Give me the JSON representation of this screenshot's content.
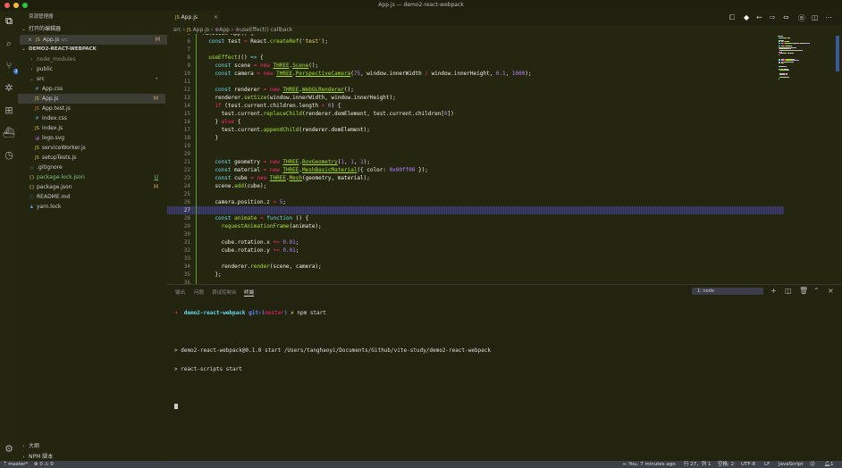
{
  "window": {
    "title": "App.js — demo2-react-webpack"
  },
  "activity_bar": [
    {
      "name": "explorer-icon",
      "glyph": "⧉"
    },
    {
      "name": "search-icon",
      "glyph": "⌕"
    },
    {
      "name": "source-control-icon",
      "glyph": "⑂",
      "badge": "3"
    },
    {
      "name": "debug-icon",
      "glyph": "✲"
    },
    {
      "name": "extensions-icon",
      "glyph": "⊞"
    },
    {
      "name": "docker-icon",
      "glyph": "⛴"
    },
    {
      "name": "timeline-icon",
      "glyph": "◷"
    }
  ],
  "sidebar": {
    "title": "资源管理器",
    "open_editors": {
      "label": "打开的编辑器",
      "items": [
        {
          "name": "App.js",
          "dir": "src",
          "status": "M"
        }
      ]
    },
    "project": {
      "label": "DEMO2-REACT-WEBPACK",
      "items": [
        {
          "label": "node_modules",
          "type": "folder",
          "depth": 0,
          "glyph": "›",
          "color": "#8a8a7a"
        },
        {
          "label": "public",
          "type": "folder",
          "depth": 0,
          "glyph": "›",
          "color": "#ccc"
        },
        {
          "label": "src",
          "type": "folder-open",
          "depth": 0,
          "glyph": "⌄",
          "color": "#ccc",
          "dot": "•"
        },
        {
          "label": "App.css",
          "depth": 1,
          "glyph": "#",
          "color": "#ccc",
          "iconColor": "#4b9cd3"
        },
        {
          "label": "App.js",
          "depth": 1,
          "glyph": "JS",
          "color": "#ccc",
          "iconColor": "#d4c24a",
          "status": "M",
          "selected": true
        },
        {
          "label": "App.test.js",
          "depth": 1,
          "glyph": "JS",
          "color": "#ccc",
          "iconColor": "#d77a3a"
        },
        {
          "label": "index.css",
          "depth": 1,
          "glyph": "#",
          "color": "#ccc",
          "iconColor": "#4b9cd3"
        },
        {
          "label": "index.js",
          "depth": 1,
          "glyph": "JS",
          "color": "#ccc",
          "iconColor": "#d4c24a"
        },
        {
          "label": "logo.svg",
          "depth": 1,
          "glyph": "◪",
          "color": "#ccc",
          "iconColor": "#a05ad0"
        },
        {
          "label": "serviceWorker.js",
          "depth": 1,
          "glyph": "JS",
          "color": "#ccc",
          "iconColor": "#d4c24a"
        },
        {
          "label": "setupTests.js",
          "depth": 1,
          "glyph": "JS",
          "color": "#ccc",
          "iconColor": "#d4c24a"
        },
        {
          "label": ".gitignore",
          "depth": 0,
          "glyph": "◇",
          "color": "#ccc",
          "iconColor": "#888"
        },
        {
          "label": "package-lock.json",
          "depth": 0,
          "glyph": "{}",
          "color": "#7bc47f",
          "iconColor": "#d4c24a",
          "status": "U"
        },
        {
          "label": "package.json",
          "depth": 0,
          "glyph": "{}",
          "color": "#ccc",
          "iconColor": "#d4c24a",
          "status": "M"
        },
        {
          "label": "README.md",
          "depth": 0,
          "glyph": "ⓘ",
          "color": "#ccc",
          "iconColor": "#4b9cd3"
        },
        {
          "label": "yarn.lock",
          "depth": 0,
          "glyph": "♟",
          "color": "#ccc",
          "iconColor": "#4b9cd3"
        }
      ]
    },
    "outline_label": "大纲",
    "npm_label": "NPM 脚本"
  },
  "editor": {
    "tab": {
      "label": "App.js",
      "close": "×"
    },
    "breadcrumb": [
      "src",
      "App.js",
      "App",
      "useEffect() callback"
    ],
    "lines": [
      {
        "n": "5",
        "t": [
          [
            "function App() {",
            "p"
          ]
        ]
      },
      {
        "n": "6",
        "t": [
          [
            "  const ",
            "k"
          ],
          [
            "test ",
            "p"
          ],
          [
            "= ",
            "o"
          ],
          [
            "React.",
            "p"
          ],
          [
            "createRef",
            "f"
          ],
          [
            "(",
            "p"
          ],
          [
            "'test'",
            "s"
          ],
          [
            ");",
            "p"
          ]
        ]
      },
      {
        "n": "7",
        "t": []
      },
      {
        "n": "8",
        "t": [
          [
            "  useEffect",
            "f"
          ],
          [
            "(() ",
            "p"
          ],
          [
            "=> ",
            "k"
          ],
          [
            "{",
            "p"
          ]
        ]
      },
      {
        "n": "9",
        "t": [
          [
            "    const ",
            "k"
          ],
          [
            "scene ",
            "p"
          ],
          [
            "= new ",
            "o"
          ],
          [
            "THREE",
            "u"
          ],
          [
            ".",
            "p"
          ],
          [
            "Scene",
            "u"
          ],
          [
            "();",
            "p"
          ]
        ]
      },
      {
        "n": "10",
        "t": [
          [
            "    const ",
            "k"
          ],
          [
            "camera ",
            "p"
          ],
          [
            "= new ",
            "o"
          ],
          [
            "THREE",
            "u"
          ],
          [
            ".",
            "p"
          ],
          [
            "PerspectiveCamera",
            "u"
          ],
          [
            "(",
            "p"
          ],
          [
            "75",
            "n"
          ],
          [
            ", window.innerWidth ",
            "p"
          ],
          [
            "/ ",
            "o"
          ],
          [
            "window.innerHeight, ",
            "p"
          ],
          [
            "0.1",
            "n"
          ],
          [
            ", ",
            "p"
          ],
          [
            "1000",
            "n"
          ],
          [
            ");",
            "p"
          ]
        ]
      },
      {
        "n": "11",
        "t": []
      },
      {
        "n": "12",
        "t": [
          [
            "    const ",
            "k"
          ],
          [
            "renderer ",
            "p"
          ],
          [
            "= new ",
            "o"
          ],
          [
            "THREE",
            "u"
          ],
          [
            ".",
            "p"
          ],
          [
            "WebGLRenderer",
            "u"
          ],
          [
            "();",
            "p"
          ]
        ]
      },
      {
        "n": "13",
        "t": [
          [
            "    renderer.",
            "p"
          ],
          [
            "setSize",
            "f"
          ],
          [
            "(window.innerWidth, window.innerHeight);",
            "p"
          ]
        ]
      },
      {
        "n": "14",
        "t": [
          [
            "    if ",
            "o"
          ],
          [
            "(test.current.children.length ",
            "p"
          ],
          [
            "> ",
            "o"
          ],
          [
            "0",
            "n"
          ],
          [
            ") {",
            "p"
          ]
        ]
      },
      {
        "n": "15",
        "t": [
          [
            "      test.current.",
            "p"
          ],
          [
            "replaceChild",
            "f"
          ],
          [
            "(renderer.domElement, test.current.children[",
            "p"
          ],
          [
            "0",
            "n"
          ],
          [
            "])",
            "p"
          ]
        ]
      },
      {
        "n": "16",
        "t": [
          [
            "    } ",
            "p"
          ],
          [
            "else ",
            "o"
          ],
          [
            "{",
            "p"
          ]
        ]
      },
      {
        "n": "17",
        "t": [
          [
            "      test.current.",
            "p"
          ],
          [
            "appendChild",
            "f"
          ],
          [
            "(renderer.domElement);",
            "p"
          ]
        ]
      },
      {
        "n": "18",
        "t": [
          [
            "    }",
            "p"
          ]
        ]
      },
      {
        "n": "19",
        "t": []
      },
      {
        "n": "20",
        "t": []
      },
      {
        "n": "21",
        "t": [
          [
            "    const ",
            "k"
          ],
          [
            "geometry ",
            "p"
          ],
          [
            "= new ",
            "o"
          ],
          [
            "THREE",
            "u"
          ],
          [
            ".",
            "p"
          ],
          [
            "BoxGeometry",
            "u"
          ],
          [
            "(",
            "p"
          ],
          [
            "1",
            "n"
          ],
          [
            ", ",
            "p"
          ],
          [
            "1",
            "n"
          ],
          [
            ", ",
            "p"
          ],
          [
            "1",
            "n"
          ],
          [
            ");",
            "p"
          ]
        ]
      },
      {
        "n": "22",
        "t": [
          [
            "    const ",
            "k"
          ],
          [
            "material ",
            "p"
          ],
          [
            "= new ",
            "o"
          ],
          [
            "THREE",
            "u"
          ],
          [
            ".",
            "p"
          ],
          [
            "MeshBasicMaterial",
            "u"
          ],
          [
            "({ color: ",
            "p"
          ],
          [
            "0x00ff00",
            "n"
          ],
          [
            " });",
            "p"
          ]
        ]
      },
      {
        "n": "23",
        "t": [
          [
            "    const ",
            "k"
          ],
          [
            "cube ",
            "p"
          ],
          [
            "= new ",
            "o"
          ],
          [
            "THREE",
            "u"
          ],
          [
            ".",
            "p"
          ],
          [
            "Mesh",
            "u"
          ],
          [
            "(geometry, material);",
            "p"
          ]
        ]
      },
      {
        "n": "24",
        "t": [
          [
            "    scene.",
            "p"
          ],
          [
            "add",
            "f"
          ],
          [
            "(cube);",
            "p"
          ]
        ]
      },
      {
        "n": "25",
        "t": []
      },
      {
        "n": "26",
        "t": [
          [
            "    camera.position.z ",
            "p"
          ],
          [
            "= ",
            "o"
          ],
          [
            "5",
            "n"
          ],
          [
            ";",
            "p"
          ]
        ]
      },
      {
        "n": "27",
        "t": [],
        "highlight": true
      },
      {
        "n": "28",
        "t": [
          [
            "    const ",
            "k"
          ],
          [
            "animate ",
            "f"
          ],
          [
            "= ",
            "o"
          ],
          [
            "function ",
            "k"
          ],
          [
            "() {",
            "p"
          ]
        ]
      },
      {
        "n": "29",
        "t": [
          [
            "      requestAnimationFrame",
            "f"
          ],
          [
            "(animate);",
            "p"
          ]
        ]
      },
      {
        "n": "30",
        "t": []
      },
      {
        "n": "31",
        "t": [
          [
            "      cube.rotation.x ",
            "p"
          ],
          [
            "+= ",
            "o"
          ],
          [
            "0.01",
            "n"
          ],
          [
            ";",
            "p"
          ]
        ]
      },
      {
        "n": "32",
        "t": [
          [
            "      cube.rotation.y ",
            "p"
          ],
          [
            "+= ",
            "o"
          ],
          [
            "0.01",
            "n"
          ],
          [
            ";",
            "p"
          ]
        ]
      },
      {
        "n": "33",
        "t": []
      },
      {
        "n": "34",
        "t": [
          [
            "      renderer.",
            "p"
          ],
          [
            "render",
            "f"
          ],
          [
            "(scene, camera);",
            "p"
          ]
        ]
      },
      {
        "n": "35",
        "t": [
          [
            "    };",
            "p"
          ]
        ]
      },
      {
        "n": "36",
        "t": []
      }
    ]
  },
  "panel": {
    "tabs": [
      "输出",
      "问题",
      "调试控制台",
      "终端"
    ],
    "active_tab": "终端",
    "terminal_select": "1: node",
    "terminal": {
      "prompt_arrow": "➜",
      "dir": "demo2-react-webpack",
      "git": "git:(",
      "branch": "master",
      "git_close": ")",
      "dirty": "✗",
      "command": "npm start",
      "output": [
        "> demo2-react-webpack@0.1.0 start /Users/tanghaoyi/Documents/Github/vite-study/demo2-react-webpack",
        "> react-scripts start"
      ]
    }
  },
  "status_bar": {
    "branch": "master*",
    "errors": "0",
    "warnings": "0",
    "blame": "You, 7 minutes ago",
    "position": "行 27，列 1",
    "line": "行 27",
    "col": "列 1",
    "spaces": "空格: 2",
    "encoding": "UTF-8",
    "eol": "LF",
    "language": "JavaScript",
    "notifications": "1"
  }
}
